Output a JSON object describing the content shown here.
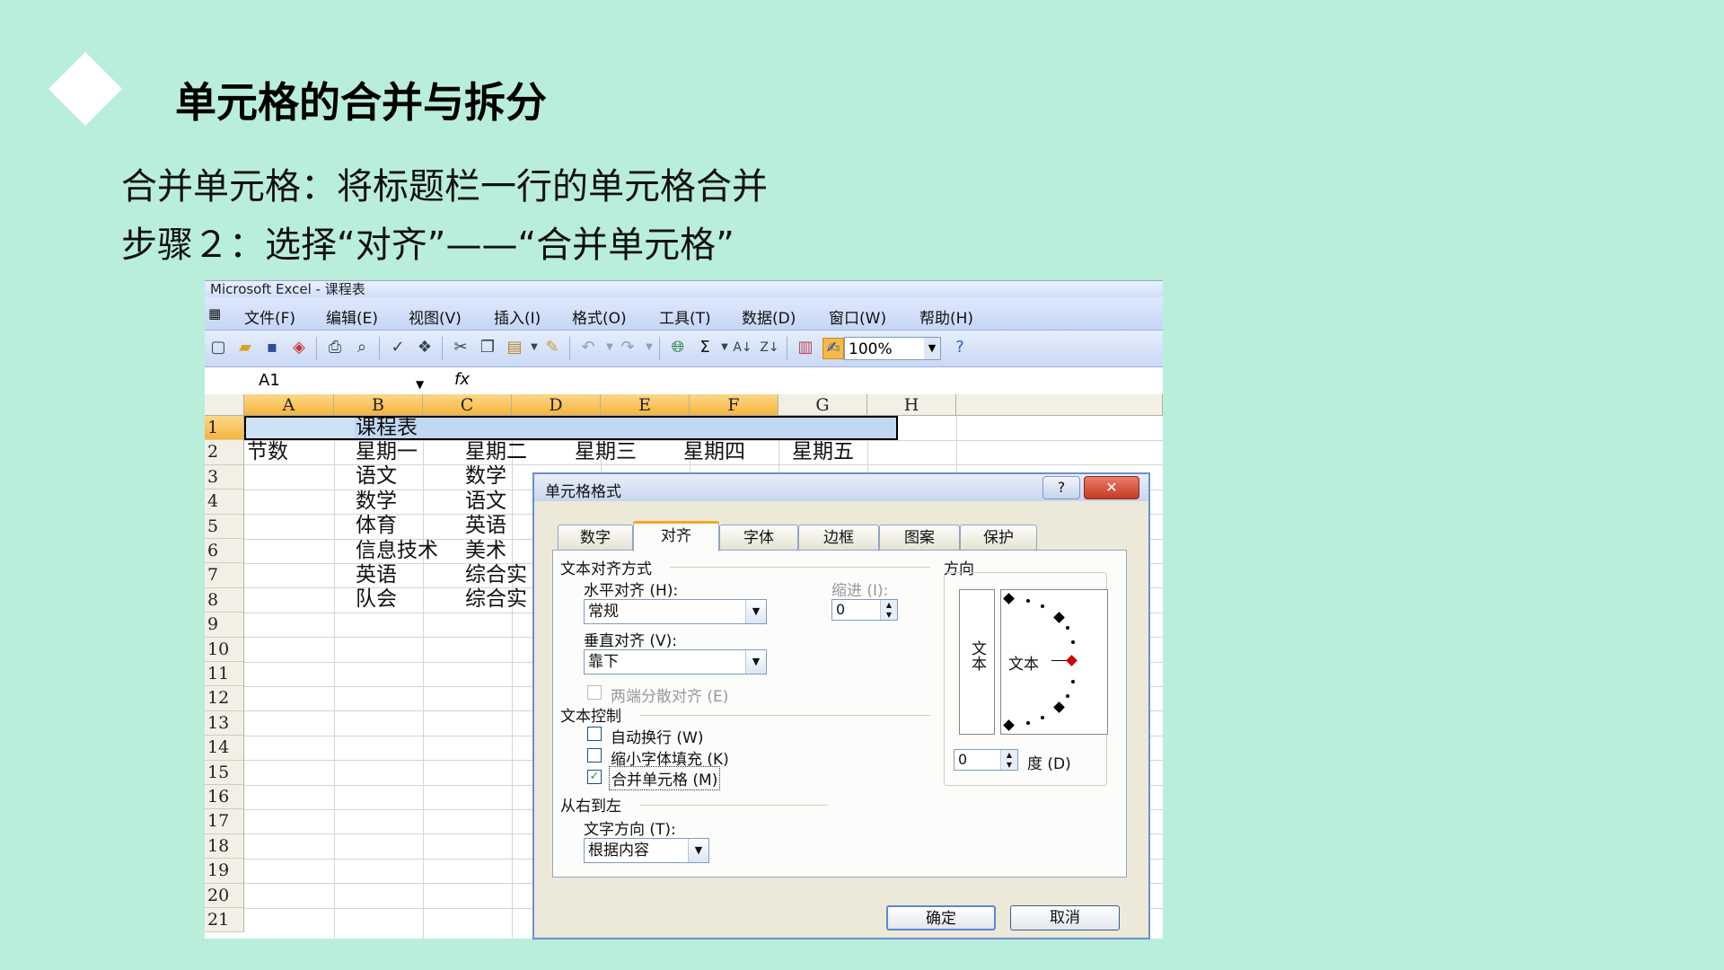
{
  "slide": {
    "title": "单元格的合并与拆分",
    "line1": "合并单元格：将标题栏一行的单元格合并",
    "line2": "步骤２：选择“对齐”——“合并单元格”"
  },
  "excel": {
    "window_title": "Microsoft Excel - 课程表",
    "menu": [
      "文件(F)",
      "编辑(E)",
      "视图(V)",
      "插入(I)",
      "格式(O)",
      "工具(T)",
      "数据(D)",
      "窗口(W)",
      "帮助(H)"
    ],
    "zoom": "100%",
    "name_box": "A1",
    "fx": "fx",
    "columns": [
      "A",
      "B",
      "C",
      "D",
      "E",
      "F",
      "G",
      "H"
    ],
    "rows": [
      "1",
      "2",
      "3",
      "4",
      "5",
      "6",
      "7",
      "8",
      "9",
      "10",
      "11",
      "12",
      "13",
      "14",
      "15",
      "16",
      "17",
      "18",
      "19",
      "20",
      "21"
    ],
    "cells": {
      "b1": "课程表",
      "a2": "节数",
      "b2": "星期一",
      "c2": "星期二",
      "d2": "星期三",
      "e2": "星期四",
      "f2": "星期五",
      "b3": "语文",
      "c3": "数学",
      "b4": "数学",
      "c4": "语文",
      "b5": "体育",
      "c5": "英语",
      "b6": "信息技术",
      "c6": "美术",
      "b7": "英语",
      "c7": "综合实",
      "b8": "队会",
      "c8": "综合实"
    }
  },
  "dialog": {
    "title": "单元格格式",
    "help": "?",
    "close": "✕",
    "tabs": [
      "数字",
      "对齐",
      "字体",
      "边框",
      "图案",
      "保护"
    ],
    "text_align_section": "文本对齐方式",
    "horizontal_label": "水平对齐 (H):",
    "horizontal_value": "常规",
    "indent_label": "缩进 (I):",
    "indent_value": "0",
    "vertical_label": "垂直对齐 (V):",
    "vertical_value": "靠下",
    "distributed_label": "两端分散对齐 (E)",
    "text_control_section": "文本控制",
    "wrap_label": "自动换行 (W)",
    "shrink_label": "缩小字体填充 (K)",
    "merge_label": "合并单元格 (M)",
    "rtl_section": "从右到左",
    "direction_label": "文字方向 (T):",
    "direction_value": "根据内容",
    "orientation_section": "方向",
    "vertical_text": "文本",
    "dial_text": "文本",
    "degree_value": "0",
    "degree_label": "度 (D)",
    "ok": "确定",
    "cancel": "取消"
  }
}
